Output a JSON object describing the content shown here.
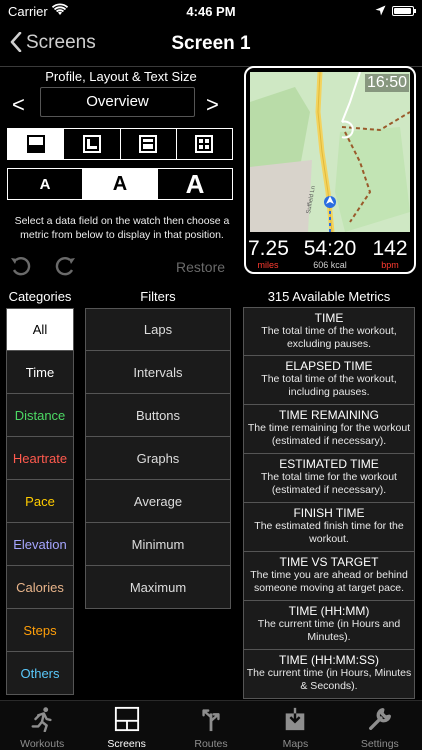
{
  "status": {
    "carrier": "Carrier",
    "time": "4:46 PM"
  },
  "nav": {
    "back_label": "Screens",
    "title": "Screen 1"
  },
  "profile": {
    "label": "Profile, Layout & Text Size",
    "prev": "<",
    "next": ">",
    "selected": "Overview"
  },
  "layouts": {
    "selected_index": 0
  },
  "text_sizes": {
    "small": "A",
    "medium": "A",
    "large": "A",
    "selected": "medium"
  },
  "help_text": "Select a data field on the watch then choose a metric from below to display in that position.",
  "restore_label": "Restore",
  "watch": {
    "clock": "16:50",
    "metrics": [
      {
        "value": "7.25",
        "unit": "miles",
        "unit_color": "#ff3b30"
      },
      {
        "value": "54:20",
        "unit": "606 kcal",
        "unit_color": "#cfcfcf"
      },
      {
        "value": "142",
        "unit": "bpm",
        "unit_color": "#ff3b30"
      }
    ],
    "road_label": "Suffield Ln"
  },
  "categories": {
    "header": "Categories",
    "items": [
      {
        "label": "All",
        "color": "#000000",
        "active": true
      },
      {
        "label": "Time",
        "color": "#ffffff"
      },
      {
        "label": "Distance",
        "color": "#4cd964"
      },
      {
        "label": "Heartrate",
        "color": "#ff5a4e"
      },
      {
        "label": "Pace",
        "color": "#ffcc00"
      },
      {
        "label": "Elevation",
        "color": "#a6a6ff"
      },
      {
        "label": "Calories",
        "color": "#e8b48a"
      },
      {
        "label": "Steps",
        "color": "#ff9f0a"
      },
      {
        "label": "Others",
        "color": "#5ac8fa"
      }
    ]
  },
  "filters": {
    "header": "Filters",
    "items": [
      "Laps",
      "Intervals",
      "Buttons",
      "Graphs",
      "Average",
      "Minimum",
      "Maximum"
    ]
  },
  "metrics": {
    "header": "315 Available Metrics",
    "items": [
      {
        "title": "TIME",
        "desc": "The total time of the workout, excluding pauses."
      },
      {
        "title": "ELAPSED TIME",
        "desc": "The total time of the workout, including pauses."
      },
      {
        "title": "TIME REMAINING",
        "desc": "The time remaining for the workout (estimated if necessary)."
      },
      {
        "title": "ESTIMATED TIME",
        "desc": "The total time for the workout (estimated if necessary)."
      },
      {
        "title": "FINISH TIME",
        "desc": "The estimated finish time for the workout."
      },
      {
        "title": "TIME VS TARGET",
        "desc": "The time you are ahead or behind someone moving at target pace."
      },
      {
        "title": "TIME (HH:MM)",
        "desc": "The current time (in Hours and Minutes)."
      },
      {
        "title": "TIME (HH:MM:SS)",
        "desc": "The current time (in Hours, Minutes & Seconds)."
      }
    ]
  },
  "tabs": [
    {
      "label": "Workouts",
      "icon": "runner-icon",
      "active": false
    },
    {
      "label": "Screens",
      "icon": "screen-layout-icon",
      "active": true
    },
    {
      "label": "Routes",
      "icon": "route-sign-icon",
      "active": false
    },
    {
      "label": "Maps",
      "icon": "map-download-icon",
      "active": false
    },
    {
      "label": "Settings",
      "icon": "wrench-icon",
      "active": false
    }
  ]
}
